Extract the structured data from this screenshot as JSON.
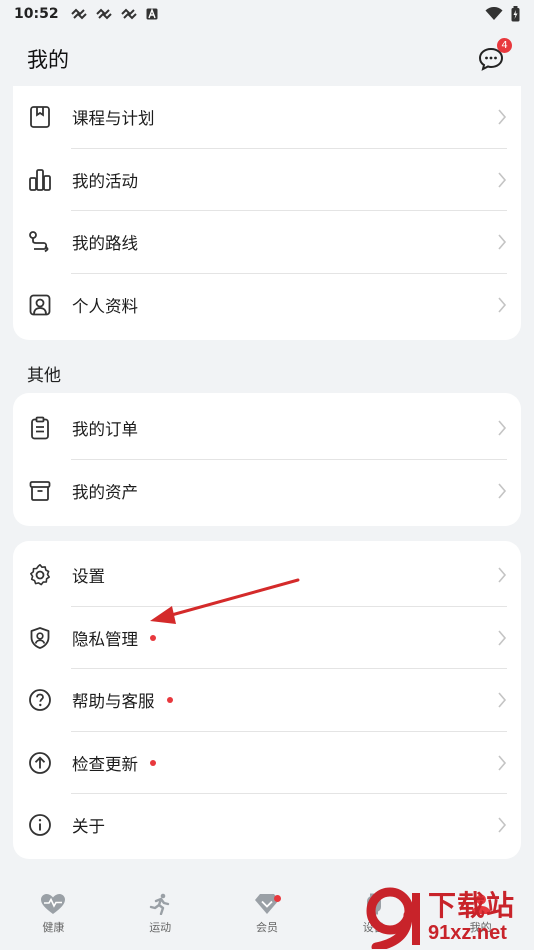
{
  "status": {
    "time": "10:52"
  },
  "header": {
    "title": "我的",
    "message_count": "4"
  },
  "group1": {
    "items": [
      {
        "label": "课程与计划",
        "icon": "bookmark-book-icon"
      },
      {
        "label": "我的活动",
        "icon": "activity-icon"
      },
      {
        "label": "我的路线",
        "icon": "route-icon"
      },
      {
        "label": "个人资料",
        "icon": "profile-icon"
      }
    ]
  },
  "section_other": {
    "title": "其他"
  },
  "group2": {
    "items": [
      {
        "label": "我的订单",
        "icon": "clipboard-icon"
      },
      {
        "label": "我的资产",
        "icon": "box-icon"
      }
    ]
  },
  "group3": {
    "items": [
      {
        "label": "设置",
        "icon": "gear-icon",
        "dot": false
      },
      {
        "label": "隐私管理",
        "icon": "shield-user-icon",
        "dot": true
      },
      {
        "label": "帮助与客服",
        "icon": "help-icon",
        "dot": true
      },
      {
        "label": "检查更新",
        "icon": "arrow-up-circle-icon",
        "dot": true
      },
      {
        "label": "关于",
        "icon": "info-icon",
        "dot": false
      }
    ]
  },
  "tabbar": {
    "tabs": [
      {
        "label": "健康",
        "icon": "heart-pulse-icon"
      },
      {
        "label": "运动",
        "icon": "runner-icon"
      },
      {
        "label": "会员",
        "icon": "diamond-icon"
      },
      {
        "label": "设备",
        "icon": "device-icon"
      },
      {
        "label": "我的",
        "icon": "user-icon"
      }
    ]
  },
  "watermark": {
    "cn": "下载站",
    "url": "91xz.net"
  },
  "colors": {
    "accent_red": "#e8383d",
    "background": "#f1f3f5",
    "card": "#ffffff"
  }
}
